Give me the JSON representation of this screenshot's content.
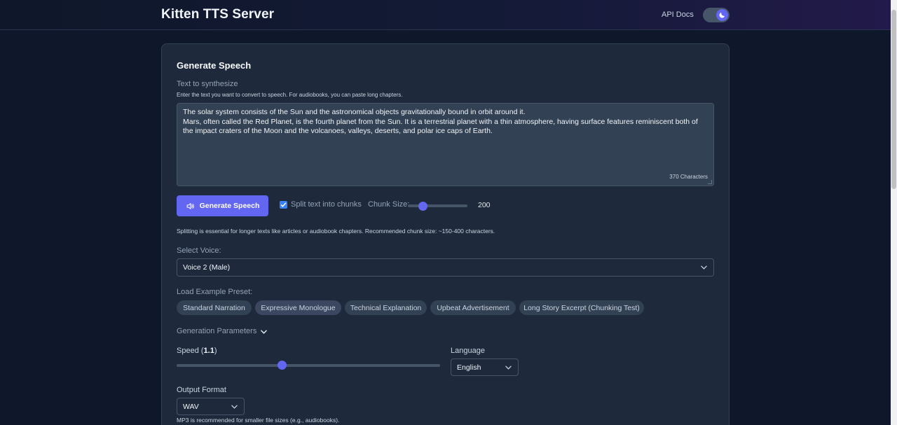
{
  "header": {
    "app_title": "Kitten TTS Server",
    "api_docs_label": "API Docs",
    "theme_toggle": {
      "state": "dark",
      "icon": "moon-icon"
    }
  },
  "generate": {
    "heading": "Generate Speech",
    "text_label": "Text to synthesize",
    "text_hint": "Enter the text you want to convert to speech. For audiobooks, you can paste long chapters.",
    "text_lines": [
      "The solar system consists of the Sun and the astronomical objects gravitationally bound in orbit around it.",
      "Mars, often called the Red Planet, is the fourth planet from the Sun. It is a terrestrial planet with a thin atmosphere, having surface features reminiscent both of the impact craters of the Moon and the volcanoes, valleys, deserts, and polar ice caps of Earth."
    ],
    "char_count": "370 Characters",
    "button_label": "Generate Speech",
    "button_icon": "speaker-icon",
    "split_label": "Split text into chunks",
    "split_checked": true,
    "chunk_label": "Chunk Size:",
    "chunk_value": "200",
    "chunk_slider": {
      "min": 100,
      "max": 500,
      "value": 200
    },
    "split_hint": "Splitting is essential for longer texts like articles or audiobook chapters. Recommended chunk size: ~150-400 characters."
  },
  "voice": {
    "label": "Select Voice:",
    "selected": "Voice 2 (Male)"
  },
  "presets": {
    "label": "Load Example Preset:",
    "items": [
      "Standard Narration",
      "Expressive Monologue",
      "Technical Explanation",
      "Upbeat Advertisement",
      "Long Story Excerpt (Chunking Test)"
    ],
    "highlighted_index": 1
  },
  "params": {
    "toggle_label": "Generation Parameters",
    "speed_label_prefix": "Speed (",
    "speed_value": "1.1",
    "speed_label_suffix": ")",
    "speed_slider": {
      "min": 0.5,
      "max": 2.0,
      "value": 1.1
    },
    "language_label": "Language",
    "language_selected": "English"
  },
  "output": {
    "label": "Output Format",
    "selected": "WAV",
    "hint": "MP3 is recommended for smaller file sizes (e.g., audiobooks)."
  },
  "colors": {
    "accent": "#6366f1",
    "background": "#0f172a",
    "card": "#1e293b",
    "checkbox": "#3b82f6"
  }
}
